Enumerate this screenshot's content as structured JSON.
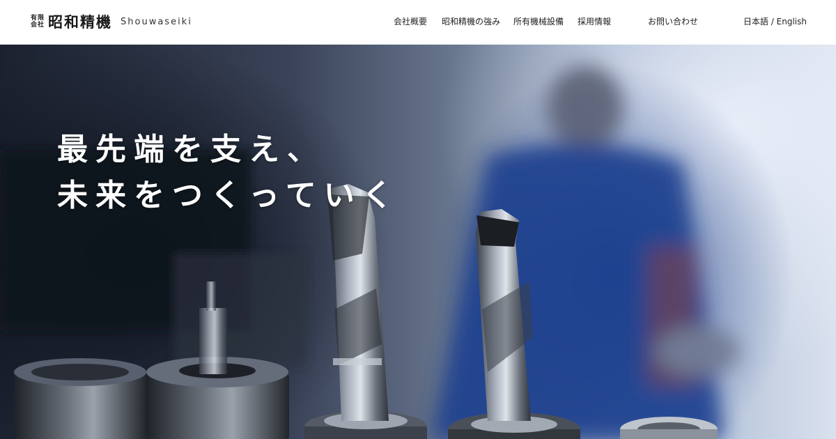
{
  "logo": {
    "prefix_top": "有限",
    "prefix_bottom": "会社",
    "main": "昭和精機",
    "en": "Shouwaseiki"
  },
  "nav": {
    "items": [
      "会社概要",
      "昭和精機の強み",
      "所有機械設備",
      "採用情報",
      "お問い合わせ",
      "日本語 / English"
    ]
  },
  "hero": {
    "line1": "最先端を支え、",
    "line2": "未来をつくっていく"
  }
}
